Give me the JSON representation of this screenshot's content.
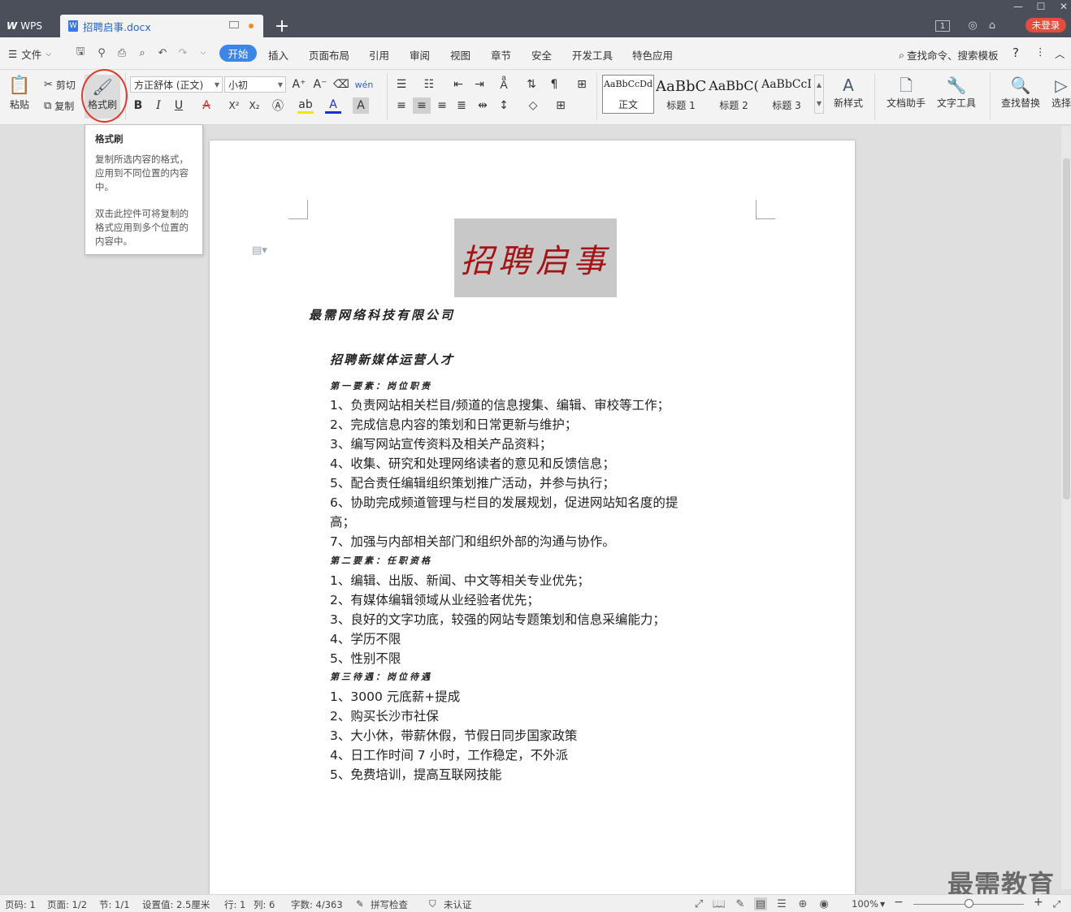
{
  "titlebar": {
    "app_name": "WPS",
    "doc_tab_title": "招聘启事.docx",
    "window_badge": "1",
    "login_label": "未登录"
  },
  "menubar": {
    "file_label": "文件",
    "tabs": [
      "开始",
      "插入",
      "页面布局",
      "引用",
      "审阅",
      "视图",
      "章节",
      "安全",
      "开发工具",
      "特色应用"
    ],
    "search_label": "查找命令、搜索模板",
    "help": "?"
  },
  "ribbon": {
    "paste_label": "粘贴",
    "cut_label": "剪切",
    "copy_label": "复制",
    "format_painter_label": "格式刷",
    "font_name": "方正舒体 (正文)",
    "font_size": "小初",
    "styles": [
      {
        "preview": "AaBbCcDd",
        "label": "正文"
      },
      {
        "preview": "AaBbC",
        "label": "标题 1"
      },
      {
        "preview": "AaBbC(",
        "label": "标题 2"
      },
      {
        "preview": "AaBbCcI",
        "label": "标题 3"
      }
    ],
    "new_style_label": "新样式",
    "doc_helper_label": "文档助手",
    "text_tools_label": "文字工具",
    "find_replace_label": "查找替换",
    "select_label": "选择"
  },
  "tooltip": {
    "title": "格式刷",
    "para1": "复制所选内容的格式，应用到不同位置的内容中。",
    "para2": "双击此控件可将复制的格式应用到多个位置的内容中。"
  },
  "document": {
    "banner": "招聘启事",
    "company": "最需网络科技有限公司",
    "job_title": "招聘新媒体运营人才",
    "section1_title": "第一要素：岗位职责",
    "section1_items": [
      "1、负责网站相关栏目/频道的信息搜集、编辑、审校等工作；",
      "2、完成信息内容的策划和日常更新与维护；",
      "3、编写网站宣传资料及相关产品资料；",
      "4、收集、研究和处理网络读者的意见和反馈信息；",
      "5、配合责任编辑组织策划推广活动，并参与执行；",
      "6、协助完成频道管理与栏目的发展规划，促进网站知名度的提",
      "高；",
      "7、加强与内部相关部门和组织外部的沟通与协作。"
    ],
    "section2_title": "第二要素：任职资格",
    "section2_items": [
      "1、编辑、出版、新闻、中文等相关专业优先；",
      "2、有媒体编辑领域从业经验者优先；",
      "3、良好的文字功底，较强的网站专题策划和信息采编能力；",
      "4、学历不限",
      "5、性别不限"
    ],
    "section3_title": "第三待遇：岗位待遇",
    "section3_items": [
      "1、3000 元底薪+提成",
      "2、购买长沙市社保",
      "3、大小休，带薪休假，节假日同步国家政策",
      "4、日工作时间 7 小时，工作稳定，不外派",
      "5、免费培训，提高互联网技能"
    ]
  },
  "statusbar": {
    "page_no": "页码: 1",
    "page": "页面: 1/2",
    "section": "节: 1/1",
    "setting": "设置值: 2.5厘米",
    "row": "行: 1",
    "col": "列: 6",
    "words": "字数: 4/363",
    "spell": "拼写检查",
    "cert": "未认证",
    "zoom": "100%"
  },
  "watermark": "最需教育",
  "colors": {
    "accent": "#3b86e6",
    "titlebar": "#4a4f5a",
    "login": "#e24d3c",
    "banner_text": "#a31515",
    "highlight_circle": "#e03a2d"
  }
}
